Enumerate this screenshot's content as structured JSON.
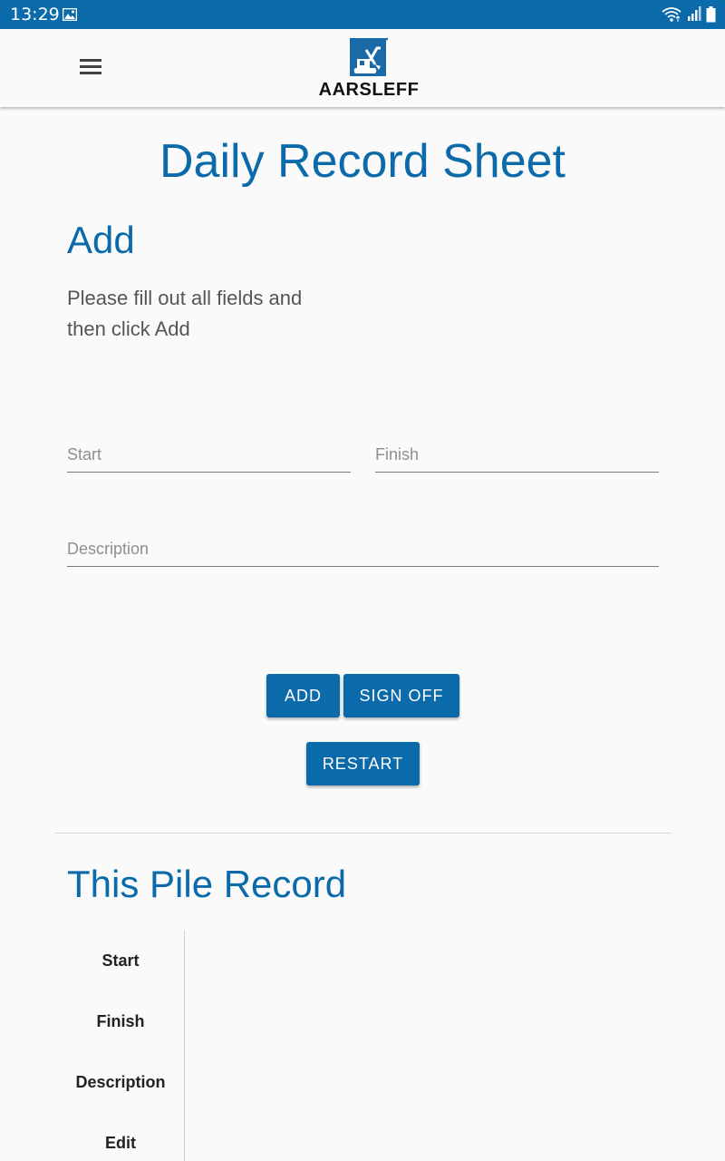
{
  "status_bar": {
    "time": "13:29",
    "icons": [
      "image-icon",
      "wifi-icon",
      "signal-icon",
      "battery-icon"
    ],
    "background": "#0a6aaa"
  },
  "header": {
    "menu_icon": "hamburger-menu-icon",
    "logo_text": "AARSLEFF",
    "logo_icon": "aarsleff-logo-icon"
  },
  "page": {
    "title": "Daily Record Sheet"
  },
  "add_section": {
    "title": "Add",
    "instructions": "Please fill out all fields and then click Add",
    "fields": {
      "start": {
        "placeholder": "Start",
        "value": ""
      },
      "finish": {
        "placeholder": "Finish",
        "value": ""
      },
      "description": {
        "placeholder": "Description",
        "value": ""
      }
    },
    "buttons": {
      "add": "ADD",
      "sign_off": "SIGN OFF",
      "restart": "RESTART"
    }
  },
  "record_section": {
    "title": "This Pile Record",
    "rows": [
      "Start",
      "Finish",
      "Description",
      "Edit"
    ]
  },
  "colors": {
    "primary": "#0a6aaa",
    "background": "#fafafa"
  }
}
